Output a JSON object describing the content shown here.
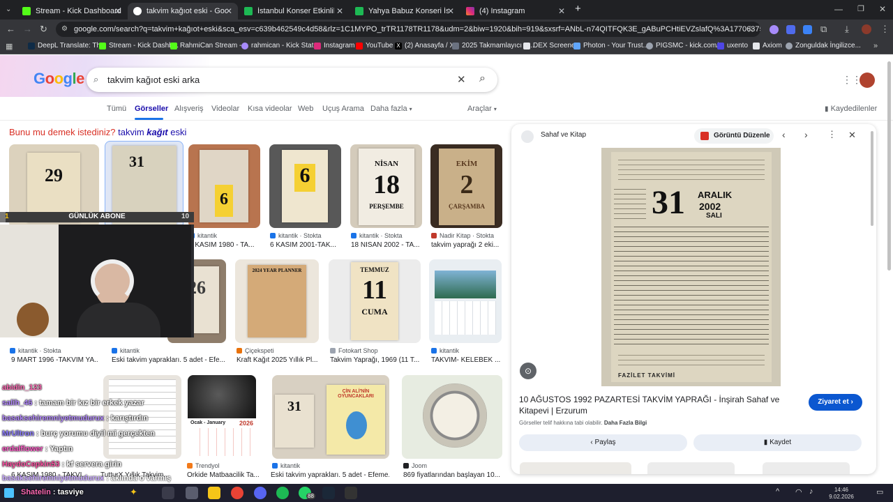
{
  "tabs": [
    {
      "label": "Stream - Kick Dashboard",
      "active": false
    },
    {
      "label": "takvim kağıot eski - Google'da",
      "active": true
    },
    {
      "label": "İstanbul Konser Etkinlik Biletler",
      "active": false
    },
    {
      "label": "Yahya Babuz Konseri İstanbul bi",
      "active": false
    },
    {
      "label": "(4) Instagram",
      "active": false
    }
  ],
  "address": "google.com/search?q=takvim+kağıot+eski&sca_esv=c639b462549c4d58&rlz=1C1MYPO_trTR1178TR1178&udm=2&biw=1920&bih=919&sxsrf=ANbL-n74QITFQK3E_gABuPCHtiEVZslafQ%3A1770637566011&ei=_siJabw534vs1g_W...",
  "bookmarks": [
    "DeepL Translate: Th...",
    "Stream - Kick Dashb...",
    "RahmiCan Stream -...",
    "rahmican - Kick Stat...",
    "Instagram",
    "YouTube",
    "(2) Anasayfa / X",
    "2025 Takmamlayıcı S...",
    "DEX Screener",
    "Photon - Your Trust...",
    "PIGSMC - kick.com/...",
    "uxento",
    "Axiom",
    "Zonguldak İngilizce..."
  ],
  "google": {
    "logo": "Google",
    "query": "takvim kağıot eski arka",
    "nav": [
      "Tümü",
      "Görseller",
      "Alışveriş",
      "Videolar",
      "Kısa videolar",
      "Web",
      "Uçuş Arama",
      "Daha fazla"
    ],
    "tools": "Araçlar",
    "saved": "Kaydedilenler",
    "didyou_prefix": "Bunu mu demek istediniz?",
    "didyou_a": "takvim",
    "didyou_b": "kağıt",
    "didyou_c": "eski"
  },
  "results_row1": [
    {
      "num": "29",
      "source": "",
      "caption": ""
    },
    {
      "num": "31",
      "source": "",
      "caption": ""
    },
    {
      "num": "6",
      "source": "kitantik",
      "caption": "6 KASIM 1980 - TA..."
    },
    {
      "num": "6",
      "source": "kitantik · Stokta",
      "caption": "6 KASIM 2001-TAK..."
    },
    {
      "num": "18",
      "top": "NİSAN",
      "bottom": "PERŞEMBE",
      "source": "kitantik · Stokta",
      "caption": "18 NİSAN 2002 - TA..."
    },
    {
      "num": "2",
      "top": "EKİM",
      "bottom": "ÇARŞAMBA",
      "source": "Nadir Kitap · Stokta",
      "caption": "takvim yaprağı 2 eki..."
    }
  ],
  "results_row2": [
    {
      "source": "kitantik · Stokta",
      "caption": "9 MART 1996 -TAKVİM YA..."
    },
    {
      "num": "26",
      "source": "kitantik",
      "caption": "Eski takvim yaprakları. 5 adet - Efe..."
    },
    {
      "title": "2024 YEAR PLANNER",
      "source": "Çiçekspeti",
      "caption": "Kraft Kağıt 2025 Yıllık Pl..."
    },
    {
      "num": "11",
      "top": "TEMMUZ",
      "bottom": "CUMA",
      "source": "Fotokart Shop",
      "caption": "Takvim Yaprağı, 1969 (11 T..."
    },
    {
      "source": "kitantik",
      "caption": "TAKVİM- KELEBEK ..."
    }
  ],
  "results_row3": [
    {
      "source": "",
      "caption": "6 KASIM 1980 - TAKVİ..."
    },
    {
      "source": "",
      "caption": "TutturX Yıllık Takvim..."
    },
    {
      "title": "Ocak - January",
      "year": "2026",
      "source": "Trendyol",
      "caption": "Orkide Matbaacilik Ta..."
    },
    {
      "num": "31",
      "title": "ÇİN ALİ'NİN OYUNCAKLARI",
      "source": "kitantik",
      "caption": "Eski takvim yaprakları. 5 adet - Efeme..."
    },
    {
      "source": "Joom",
      "caption": "869 fiyatlarından başlayan 10..."
    }
  ],
  "panel": {
    "site": "Sahaf ve Kitap",
    "edit_btn": "Görüntü Düzenle",
    "cal_month": "ARALIK",
    "cal_year": "2002",
    "cal_day": "31",
    "cal_weekday": "SALI",
    "cal_footer": "FAZİLET TAKVİMİ",
    "title": "10 AĞUSTOS 1992 PAZARTESİ TAKVİM YAPRAĞI - İnşirah Sahaf ve Kitapevi | Erzurum",
    "visit": "Ziyaret et",
    "copyright": "Görseller telif hakkına tabi olabilir.",
    "more": "Daha Fazla Bilgi",
    "share": "Paylaş",
    "save": "Kaydet"
  },
  "stream": {
    "goal_left": "1",
    "goal_label": "GÜNLÜK ABONE",
    "goal_right": "10",
    "chat": [
      {
        "user": "abidin_123",
        "msg": ""
      },
      {
        "user": "salih_46",
        "msg": ": tamam bir kız bir erkek yazar"
      },
      {
        "user": "basaksehiremniyetmudurux",
        "msg": ": karıştırdın"
      },
      {
        "user": "MrUltron",
        "msg": ": burç yorumu diyil mi gerçekten"
      },
      {
        "user": "erdalflower",
        "msg": ": Yaptın"
      },
      {
        "user": "HaydoCepkin53",
        "msg": ": kf servera girin"
      },
      {
        "user": "basaksehiremniyetmudurux",
        "msg": ": aklında o varmış"
      },
      {
        "user": "Shatelin",
        "msg": ": tasviye"
      }
    ]
  },
  "taskbar": {
    "time": "14:46",
    "date": "9.02.2026",
    "badge": "88"
  }
}
